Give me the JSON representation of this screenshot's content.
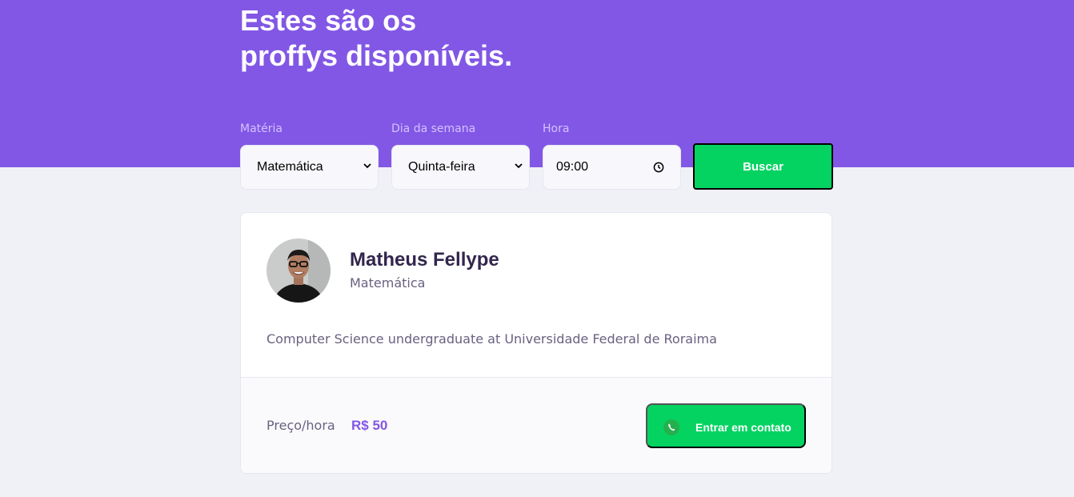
{
  "header": {
    "title_line1": "Estes são os",
    "title_line2": "proffys disponíveis."
  },
  "filters": {
    "subject": {
      "label": "Matéria",
      "value": "Matemática"
    },
    "weekday": {
      "label": "Dia da semana",
      "value": "Quinta-feira"
    },
    "time": {
      "label": "Hora",
      "value": "09:00"
    },
    "search_label": "Buscar"
  },
  "teacher": {
    "name": "Matheus Fellype",
    "subject": "Matemática",
    "bio": "Computer Science undergraduate at Universidade Federal de Roraima",
    "price_label": "Preço/hora",
    "price_value": "R$ 50",
    "contact_label": "Entrar em contato"
  },
  "colors": {
    "primary": "#8257e5",
    "secondary": "#04d361",
    "background": "#f0f0f7"
  }
}
